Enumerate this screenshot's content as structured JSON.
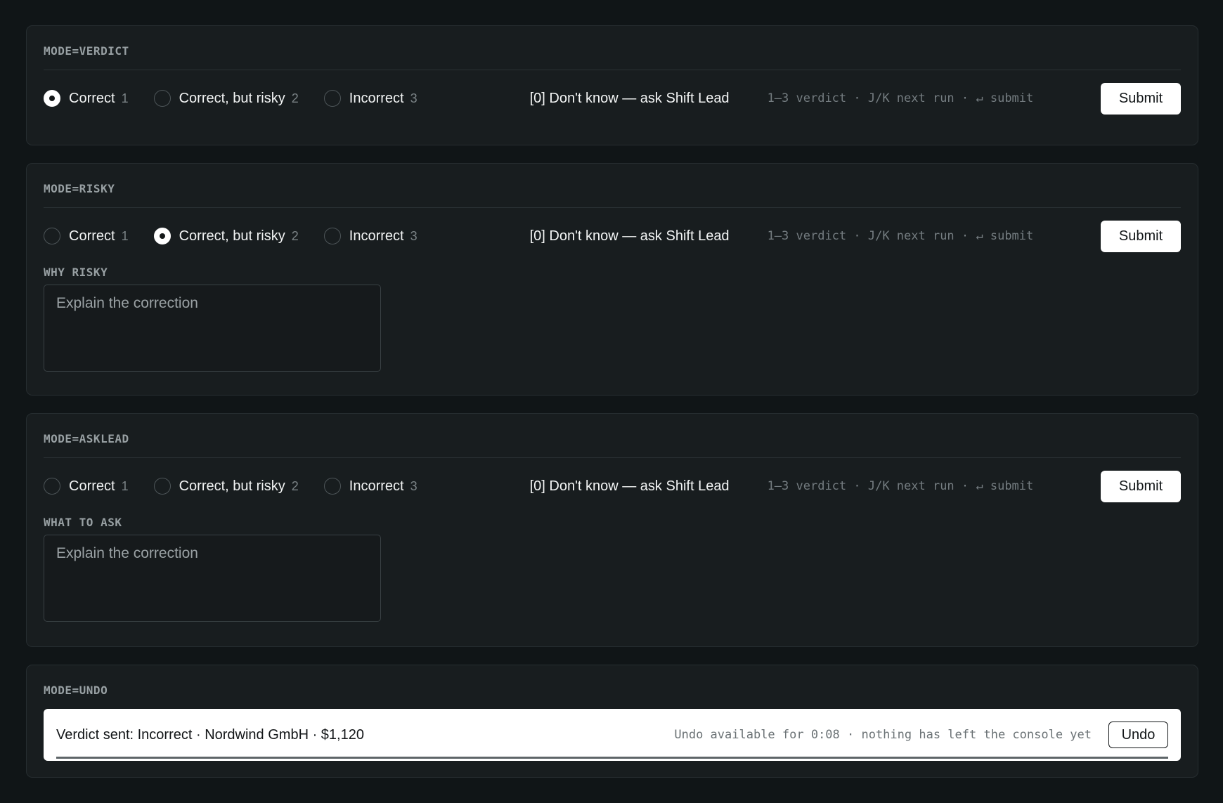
{
  "options": [
    {
      "label": "Correct",
      "key": "1"
    },
    {
      "label": "Correct, but risky",
      "key": "2"
    },
    {
      "label": "Incorrect",
      "key": "3"
    }
  ],
  "dont_know": "[0] Don't know — ask Shift Lead",
  "hint": "1–3 verdict · J/K next run · ↵ submit",
  "submit_label": "Submit",
  "placeholder": "Explain the correction",
  "panels": {
    "verdict": {
      "mode": "MODE=VERDICT",
      "selected": "Correct"
    },
    "risky": {
      "mode": "MODE=RISKY",
      "selected": "Correct, but risky",
      "field_label": "WHY RISKY"
    },
    "asklead": {
      "mode": "MODE=ASKLEAD",
      "selected": null,
      "field_label": "WHAT TO ASK"
    },
    "undo": {
      "mode": "MODE=UNDO",
      "message": "Verdict sent: Incorrect · Nordwind GmbH · $1,120",
      "note": "Undo available for 0:08 · nothing has left the console yet",
      "undo_label": "Undo",
      "progress": 1.0
    }
  }
}
